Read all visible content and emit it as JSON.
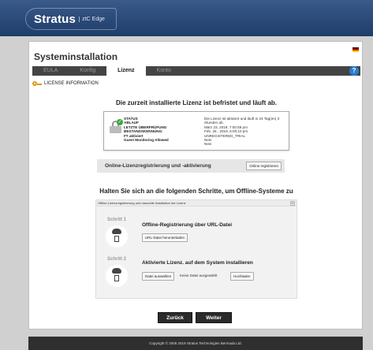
{
  "brand": {
    "name": "Stratus",
    "sub": "ztC Edge"
  },
  "page": {
    "title": "Systeminstallation"
  },
  "steps": [
    "EULA",
    "Konfig",
    "Lizenz",
    "Konto"
  ],
  "active_step": 2,
  "help_glyph": "?",
  "section": {
    "title": "LICENSE INFORMATION"
  },
  "license": {
    "headline": "Die zurzeit installierte Lizenz ist befristet und läuft ab.",
    "labels": [
      "STATUS",
      "ABLAUF",
      "LETZTE ÜBERPRÜFUNG",
      "BESTANDSKENNUNG:",
      "FT aktiviert",
      "Guest Monitoring Allowed"
    ],
    "values": [
      "Die Lizenz ist aktiviert und läuft in 24 Tag(en) 3 Stunden ab.",
      "März 23, 2019, 7:00:59 pm",
      "Feb. 26 , 2019, 6:00:10 pm",
      "UNREGISTERED_TRIAL",
      "Nein",
      "Nein"
    ]
  },
  "online": {
    "label": "Online-Lizenzregistrierung und -aktivierung",
    "button": "Online registrieren"
  },
  "offline": {
    "headline": "Halten Sie sich an die folgenden Schritte, um Offline-Systeme zu",
    "accordion_title": "Offline-Lizenzregistrierung und manuelle Installation der Lizenz",
    "toggle": "–",
    "step1": {
      "num": "Schritt 1",
      "title": "Offline-Registrierung über URL-Datei",
      "button": "URL-Datei herunterladen"
    },
    "step2": {
      "num": "Schritt 2",
      "title": "Aktivierte Lizenz. auf dem System installieren",
      "choose": "Datei auswählen",
      "no_file": "Keine Datei ausgewählt",
      "upload": "Hochladen"
    }
  },
  "nav": {
    "back": "Zurück",
    "next": "Weiter"
  },
  "footer": "Copyright © 2006 2019 Stratus Technologies Bermuda Ltd.",
  "colors": {
    "topbar": "#1f3d6a",
    "check": "#39a844",
    "help": "#2a7bd0"
  },
  "icons": [
    "key-icon",
    "lock-check-icon",
    "cloud-icon",
    "document-icon",
    "help-icon",
    "flag-icon"
  ]
}
